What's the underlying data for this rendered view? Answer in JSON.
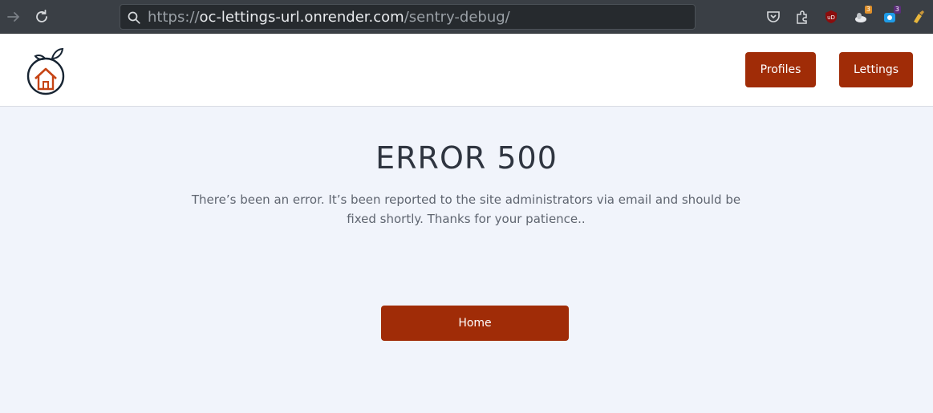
{
  "browser": {
    "url_prefix": "https://",
    "url_host": "oc-lettings-url.onrender.com",
    "url_path": "/sentry-debug/",
    "extensions": [
      {
        "icon": "pocket-icon"
      },
      {
        "icon": "puzzle-extensions-icon"
      },
      {
        "icon": "ublock-origin-icon",
        "label": "uD"
      },
      {
        "icon": "extension-feet-icon",
        "badge": "3"
      },
      {
        "icon": "extension-blue-icon",
        "badge": "3"
      },
      {
        "icon": "extension-brush-icon"
      }
    ]
  },
  "header": {
    "logo_icon": "orange-house-logo-icon",
    "nav": {
      "profiles_label": "Profiles",
      "lettings_label": "Lettings"
    }
  },
  "main": {
    "title": "ERROR 500",
    "message": "There’s been an error. It’s been reported to the site administrators via email and should be fixed shortly. Thanks for your patience..",
    "home_label": "Home"
  },
  "colors": {
    "accent": "#a02c07",
    "background": "#f1f4fb",
    "header_bg": "#ffffff",
    "title": "#2f3540",
    "text": "#5f6570",
    "browser_bar": "#3a3f45"
  }
}
